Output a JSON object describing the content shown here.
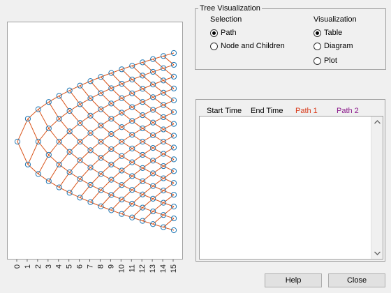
{
  "tree_visualization": {
    "title": "Tree Visualization",
    "selection": {
      "heading": "Selection",
      "options": [
        {
          "label": "Path",
          "checked": true
        },
        {
          "label": "Node and Children",
          "checked": false
        }
      ]
    },
    "visualization": {
      "heading": "Visualization",
      "options": [
        {
          "label": "Table",
          "checked": true
        },
        {
          "label": "Diagram",
          "checked": false
        },
        {
          "label": "Plot",
          "checked": false
        }
      ]
    }
  },
  "table": {
    "columns": [
      {
        "label": "Start Time",
        "color": "#000000"
      },
      {
        "label": "End Time",
        "color": "#000000"
      },
      {
        "label": "Path 1",
        "color": "#d93a1a"
      },
      {
        "label": "Path 2",
        "color": "#8b1a8b"
      }
    ],
    "rows": []
  },
  "buttons": {
    "help": "Help",
    "close": "Close"
  },
  "chart_data": {
    "type": "scatter",
    "description_type": "recombining tree",
    "x_ticks": [
      "0",
      "1",
      "2",
      "3",
      "4",
      "5",
      "6",
      "7",
      "8",
      "9",
      "10",
      "11",
      "12",
      "13",
      "14",
      "15"
    ],
    "levels": 16,
    "node_color": "#1f77b4",
    "edge_color": "#d95319",
    "xlim": [
      0,
      15
    ]
  }
}
